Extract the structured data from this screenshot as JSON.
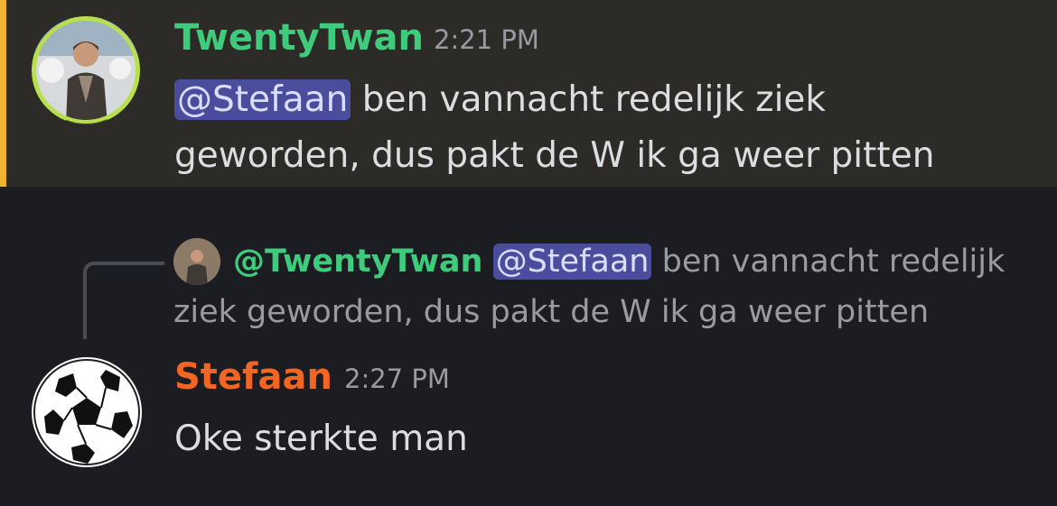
{
  "message1": {
    "username": "TwentyTwan",
    "timestamp": "2:21 PM",
    "mention": "@Stefaan",
    "text": " ben vannacht redelijk ziek geworden, dus pakt de W ik ga weer pitten",
    "username_color": "#3ecb7c",
    "highlight_color": "#f0b232"
  },
  "reply_preview": {
    "username": "@TwentyTwan",
    "mention": "@Stefaan",
    "text": " ben vannacht redelijk ziek geworden, dus pakt de W ik ga weer pitten"
  },
  "message2": {
    "username": "Stefaan",
    "timestamp": "2:27 PM",
    "text": "Oke sterkte man",
    "username_color": "#f26522"
  },
  "icons": {
    "avatar1": "user-photo-avatar",
    "avatar_small": "user-photo-avatar",
    "avatar2": "soccer-ball-avatar"
  }
}
